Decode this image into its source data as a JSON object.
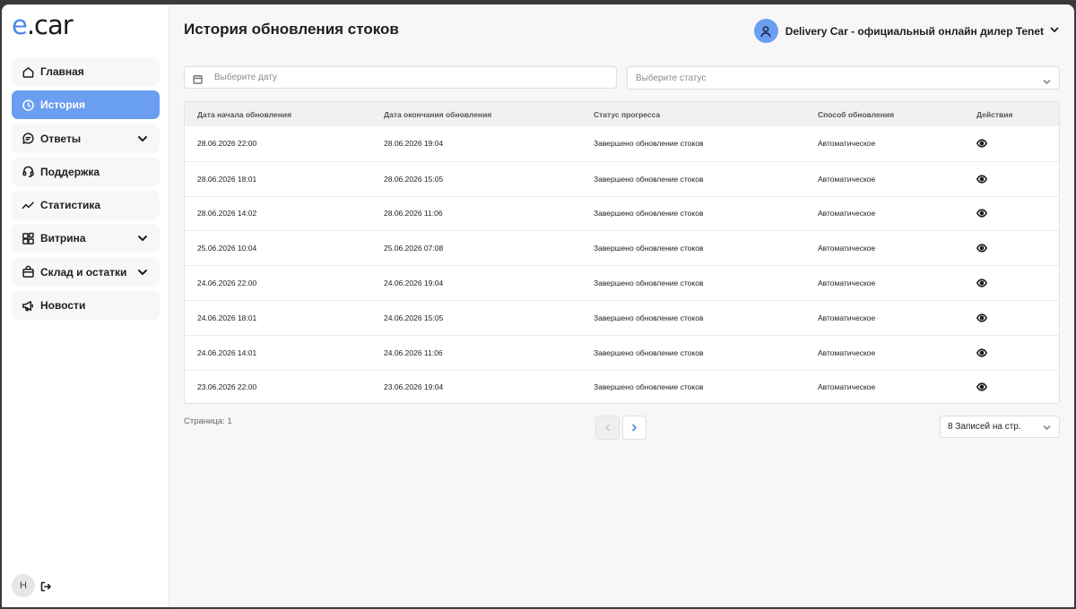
{
  "app": {
    "logo_e": "e",
    "logo_rest": ".car"
  },
  "sidebar": {
    "items": [
      {
        "label": "Главная",
        "icon": "home-icon",
        "has_chevron": false,
        "active": false
      },
      {
        "label": "История",
        "icon": "clock-icon",
        "has_chevron": false,
        "active": true
      },
      {
        "label": "Ответы",
        "icon": "chat-icon",
        "has_chevron": true,
        "active": false
      },
      {
        "label": "Поддержка",
        "icon": "headset-icon",
        "has_chevron": false,
        "active": false
      },
      {
        "label": "Статистика",
        "icon": "trend-icon",
        "has_chevron": false,
        "active": false
      },
      {
        "label": "Витрина",
        "icon": "grid-icon",
        "has_chevron": true,
        "active": false
      },
      {
        "label": "Склад и остатки",
        "icon": "bag-icon",
        "has_chevron": true,
        "active": false
      },
      {
        "label": "Новости",
        "icon": "megaphone-icon",
        "has_chevron": false,
        "active": false
      }
    ],
    "user_initial": "Н"
  },
  "header": {
    "title": "История обновления стоков",
    "dealer": "Delivery Car - официальный онлайн дилер Tenet"
  },
  "filters": {
    "date_placeholder": "Выберите дату",
    "status_placeholder": "Выберите статус"
  },
  "table": {
    "columns": [
      "Дата начала обновления",
      "Дата окончания обновления",
      "Статус прогресса",
      "Способ обновления",
      "Действия"
    ],
    "rows": [
      [
        "28.06.2026 22:00",
        "28.06.2026 19:04",
        "Завершено обновление стоков",
        "Автоматическое"
      ],
      [
        "28.06.2026 18:01",
        "28.06.2026 15:05",
        "Завершено обновление стоков",
        "Автоматическое"
      ],
      [
        "28.06.2026 14:02",
        "28.06.2026 11:06",
        "Завершено обновление стоков",
        "Автоматическое"
      ],
      [
        "25.06.2026 10:04",
        "25.06.2026 07:08",
        "Завершено обновление стоков",
        "Автоматическое"
      ],
      [
        "24.06.2026 22:00",
        "24.06.2026 19:04",
        "Завершено обновление стоков",
        "Автоматическое"
      ],
      [
        "24.06.2026 18:01",
        "24.06.2026 15:05",
        "Завершено обновление стоков",
        "Автоматическое"
      ],
      [
        "24.06.2026 14:01",
        "24.06.2026 11:06",
        "Завершено обновление стоков",
        "Автоматическое"
      ],
      [
        "23.06.2026 22:00",
        "23.06.2026 19:04",
        "Завершено обновление стоков",
        "Автоматическое"
      ]
    ]
  },
  "pagination": {
    "page_label": "Страница: 1",
    "per_page": "8 Записей на стр."
  },
  "colors": {
    "accent": "#6a9ef0",
    "brand": "#4f86e8"
  }
}
